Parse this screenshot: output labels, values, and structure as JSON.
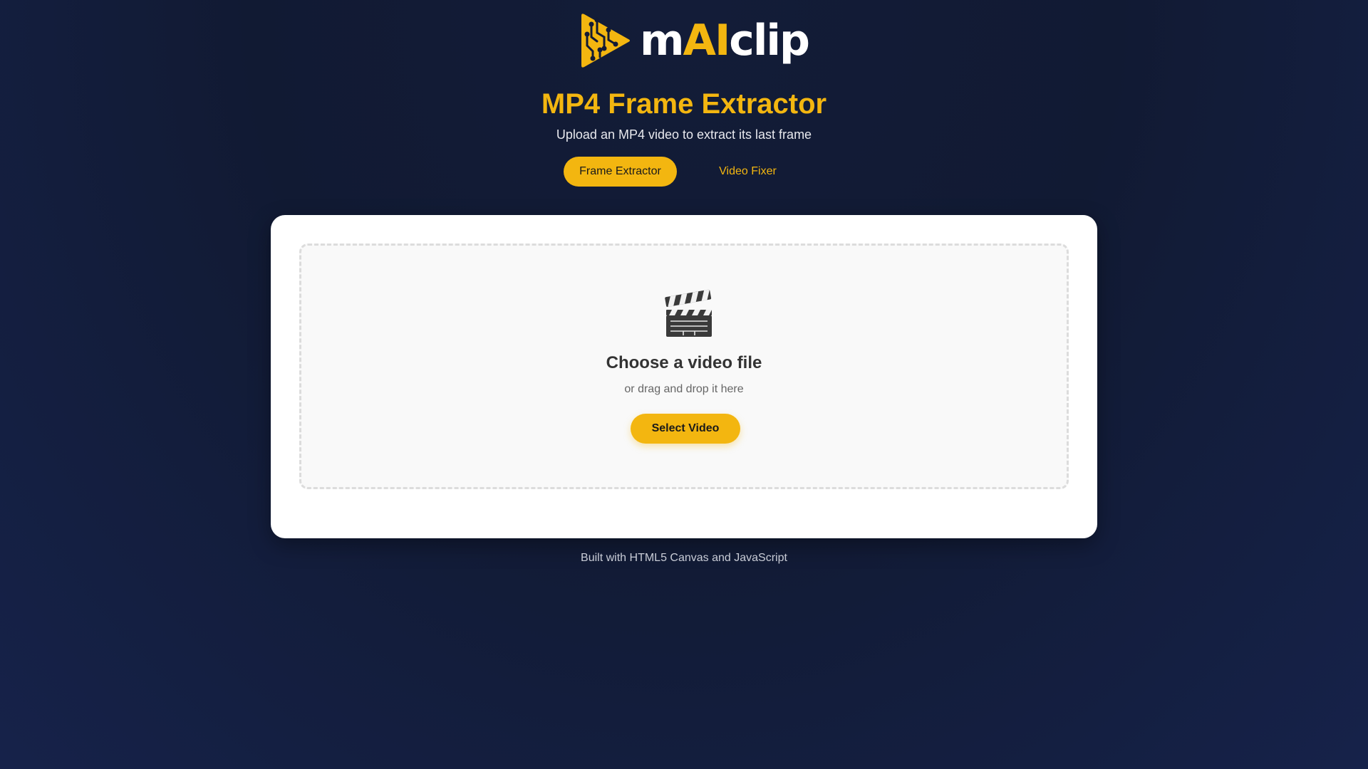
{
  "brand": {
    "logo_prefix": "m",
    "logo_highlight": "AI",
    "logo_suffix": "clip",
    "accent_color": "#f3b610"
  },
  "header": {
    "title": "MP4 Frame Extractor",
    "subtitle": "Upload an MP4 video to extract its last frame"
  },
  "tabs": [
    {
      "label": "Frame Extractor",
      "active": true
    },
    {
      "label": "Video Fixer",
      "active": false
    }
  ],
  "upload": {
    "icon": "clapperboard-icon",
    "title": "Choose a video file",
    "subtitle": "or drag and drop it here",
    "button_label": "Select Video"
  },
  "footer": {
    "text": "Built with HTML5 Canvas and JavaScript"
  }
}
